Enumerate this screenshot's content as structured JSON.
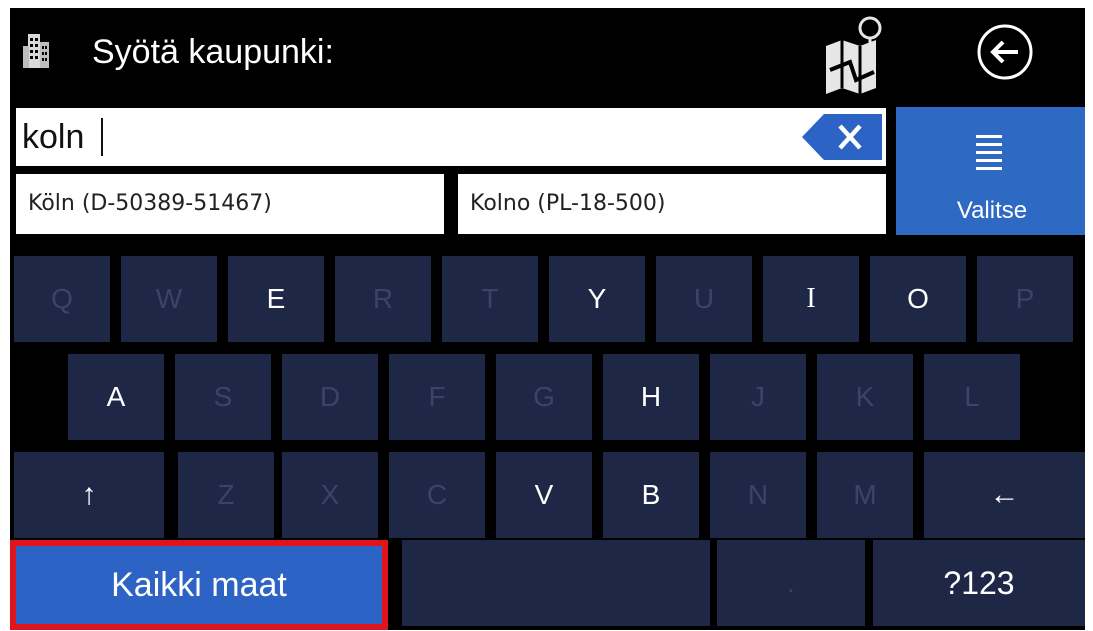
{
  "header": {
    "title": "Syötä kaupunki:"
  },
  "search": {
    "value": "koln"
  },
  "suggestions": [
    {
      "label": "Köln (D-50389-51467)"
    },
    {
      "label": "Kolno (PL-18-500)"
    }
  ],
  "select_button": {
    "label": "Valitse"
  },
  "keyboard": {
    "row1": [
      "Q",
      "W",
      "E",
      "R",
      "T",
      "Y",
      "U",
      "I",
      "O",
      "P"
    ],
    "row2": [
      "A",
      "S",
      "D",
      "F",
      "G",
      "H",
      "J",
      "K",
      "L"
    ],
    "row3": [
      "↑",
      "Z",
      "X",
      "C",
      "V",
      "B",
      "N",
      "M",
      "←"
    ],
    "all_countries_label": "Kaikki maat",
    "dot_label": ".",
    "symbols_label": "?123"
  },
  "colors": {
    "screen_bg": "#000000",
    "key_bg": "#1f2747",
    "key_disabled_text": "#3b4467",
    "accent_blue": "#2e69c4",
    "highlight_red": "#e0141b"
  }
}
